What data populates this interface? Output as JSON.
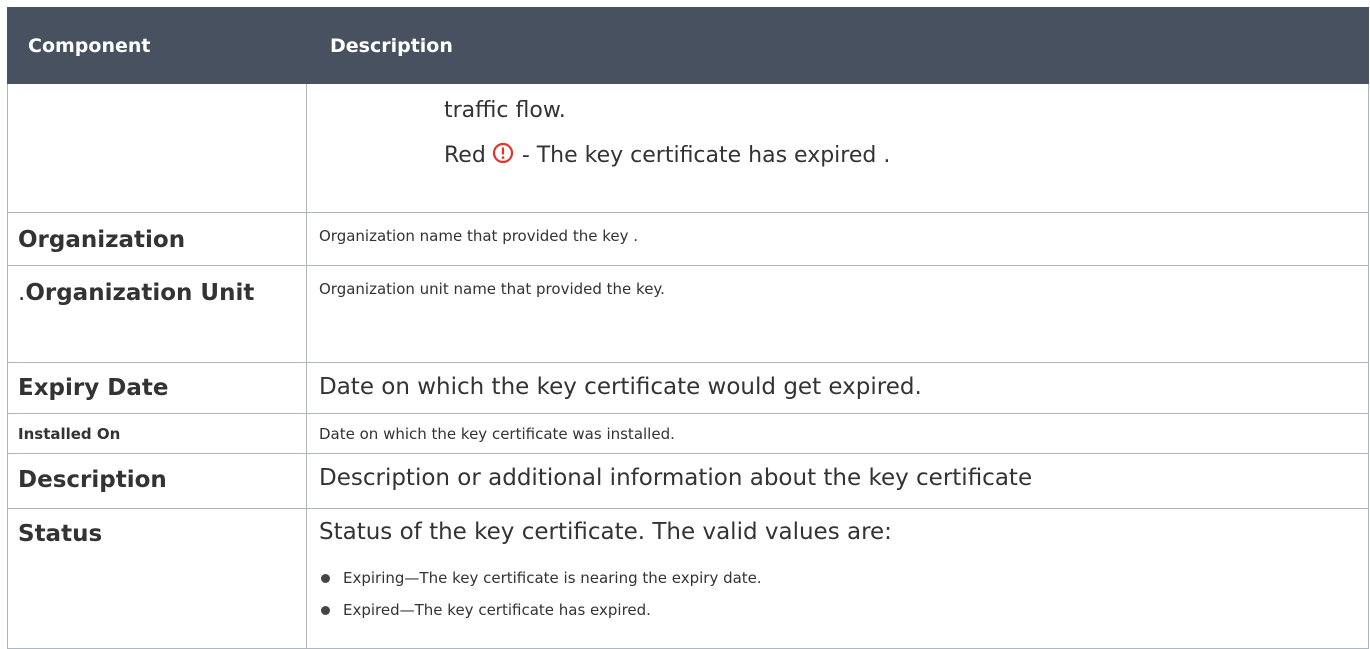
{
  "header": {
    "col1": "Component",
    "col2": "Description"
  },
  "rows": {
    "continued": {
      "line1": "traffic flow.",
      "red_prefix": "Red",
      "red_suffix": "- The key certificate has expired ."
    },
    "organization": {
      "name": "Organization",
      "desc": "Organization name that provided the key ."
    },
    "organization_unit": {
      "prefix": ".",
      "name": "Organization Unit",
      "desc": "Organization unit name that provided the key."
    },
    "expiry_date": {
      "name": "Expiry Date",
      "desc": "Date on which the key certificate would get expired."
    },
    "installed_on": {
      "name": "Installed On",
      "desc": "Date on which the key certificate was installed."
    },
    "description": {
      "name": "Description",
      "desc": "Description or additional information about the key certificate"
    },
    "status": {
      "name": "Status",
      "desc": "Status of the key certificate. The valid values are:",
      "values": [
        "Expiring—The key certificate is nearing the expiry date.",
        "Expired—The key certificate has expired."
      ]
    }
  },
  "icons": {
    "red_alert": "alert-circle-icon",
    "red_alert_color": "#e5332a"
  }
}
